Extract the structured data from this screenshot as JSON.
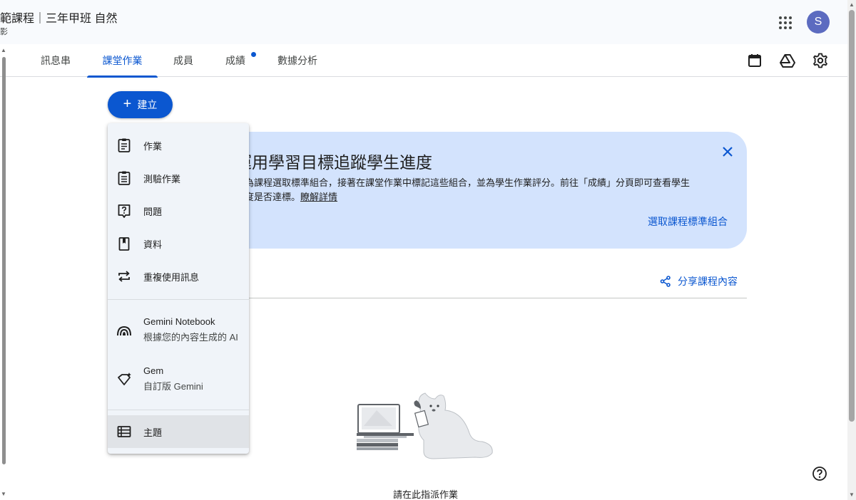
{
  "header": {
    "course_title": "範課程｜三年甲班 自然",
    "course_subtitle": "影",
    "avatar_letter": "S",
    "avatar_color": "#5c6bc0"
  },
  "tabs": [
    {
      "label": "訊息串"
    },
    {
      "label": "課堂作業",
      "active": true
    },
    {
      "label": "成員"
    },
    {
      "label": "成績",
      "has_dot": true
    },
    {
      "label": "數據分析"
    }
  ],
  "tab_icons": [
    "calendar-icon",
    "drive-icon",
    "settings-icon"
  ],
  "create_button": {
    "label": "建立"
  },
  "banner": {
    "title": "運用學習目標追蹤學生進度",
    "desc_line1": "先為課程選取標準組合，接著在課堂作業中標記這些組合，並為學生作業評分。前往「成績」分頁即可查看學生",
    "desc_line2_prefix": "進度是否達標。",
    "desc_link": "瞭解詳情",
    "action": "選取課程標準組合"
  },
  "share": {
    "label": "分享課程內容"
  },
  "empty_state": {
    "text": "請在此指派作業"
  },
  "menu": {
    "items": [
      {
        "label": "作業",
        "icon": "assignment-icon"
      },
      {
        "label": "測驗作業",
        "icon": "quiz-assignment-icon"
      },
      {
        "label": "問題",
        "icon": "question-icon"
      },
      {
        "label": "資料",
        "icon": "material-icon"
      },
      {
        "label": "重複使用訊息",
        "icon": "reuse-post-icon"
      }
    ],
    "gemini_notebook": {
      "title": "Gemini Notebook",
      "subtitle": "根據您的內容生成的 AI"
    },
    "gem": {
      "title": "Gem",
      "subtitle": "自訂版 Gemini"
    },
    "topic": {
      "label": "主題",
      "icon": "topic-icon"
    }
  },
  "colors": {
    "accent": "#0b57d0",
    "banner_bg": "#d3e3fd",
    "menu_bg": "#f0f4f9"
  }
}
